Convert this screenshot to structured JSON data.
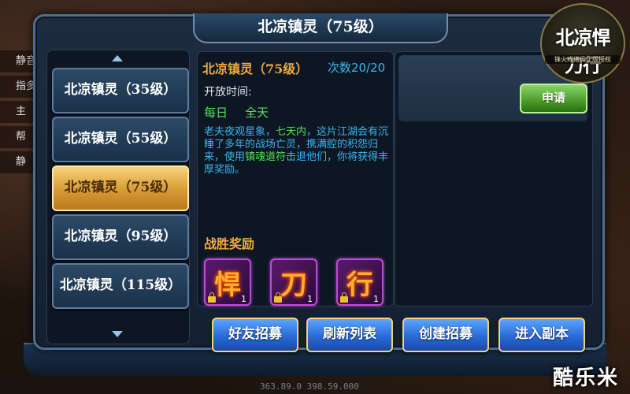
{
  "dialog": {
    "title": "北凉镇灵（75级）",
    "close_icon": "×"
  },
  "dungeon_list": {
    "items": [
      {
        "label": "北凉镇灵（35级）",
        "selected": false
      },
      {
        "label": "北凉镇灵（55级）",
        "selected": false
      },
      {
        "label": "北凉镇灵（75级）",
        "selected": true
      },
      {
        "label": "北凉镇灵（95级）",
        "selected": false
      },
      {
        "label": "北凉镇灵（115级）",
        "selected": false
      }
    ]
  },
  "detail": {
    "title": "北凉镇灵（75级）",
    "count": "次数20/20",
    "open_time_label": "开放时间:",
    "open_day": "每日",
    "open_time": "全天",
    "desc_1": "老夫夜观星象，",
    "desc_2": "七天内",
    "desc_3": "，这片江湖会有沉睡了多年的战场亡灵，携满腔的积怨归来，使用",
    "desc_4": "镇魂道符",
    "desc_5": "击退他们，你将获得丰厚奖励。",
    "reward_label": "战胜奖励",
    "rewards": [
      {
        "glyph": "悍",
        "qty": "1"
      },
      {
        "glyph": "刀",
        "qty": "1"
      },
      {
        "glyph": "行",
        "qty": "1"
      }
    ]
  },
  "right_panel": {
    "apply_label": "申请"
  },
  "buttons": {
    "friend_recruit": "好友招募",
    "refresh_list": "刷新列表",
    "create_recruit": "创建招募",
    "enter_dungeon": "进入副本"
  },
  "background": {
    "side_rows": [
      "静音",
      "指多",
      "主",
      "帮",
      "静"
    ],
    "coords": "363.89.0  398.59.000"
  },
  "logo": {
    "title": "北凉悍刀行",
    "subtitle": "锋火戏诸侯正版授权"
  },
  "watermark": "酷乐米",
  "colors": {
    "accent_orange": "#f2a93b",
    "accent_blue": "#39b6f0",
    "accent_green": "#55e05a",
    "selected_gold": "#d79a34"
  }
}
